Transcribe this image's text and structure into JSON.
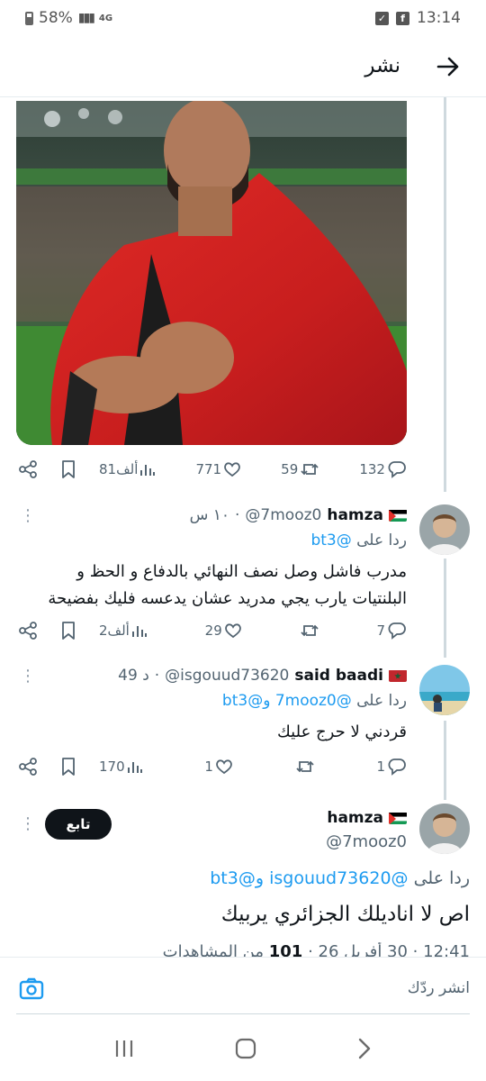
{
  "status_bar": {
    "battery": "58%",
    "network": "4G",
    "time": "13:14"
  },
  "header": {
    "title": "نشر"
  },
  "main_post_actions": {
    "replies": "132",
    "reposts": "59",
    "likes": "771",
    "views": "81ألف"
  },
  "replies": [
    {
      "name": "hamza",
      "handle": "@7mooz0",
      "time": "١٠ س",
      "reply_to_prefix": "ردا على",
      "reply_to": "@bt3",
      "text": "مدرب فاشل وصل نصف النهائي بالدفاع و الحظ و البلنتيات يارب يجي مدريد عشان يدعسه فليك بفضيحة",
      "replies": "7",
      "reposts": "",
      "likes": "29",
      "views": "2ألف"
    },
    {
      "name": "said baadi",
      "handle": "@isgouud73620",
      "time": "49 د",
      "reply_to_prefix": "ردا على",
      "reply_to": "@7mooz0 و@bt3",
      "text": "قردني لا حرج عليك",
      "replies": "1",
      "reposts": "",
      "likes": "1",
      "views": "170"
    }
  ],
  "focused_post": {
    "name": "hamza",
    "handle": "@7mooz0",
    "follow_label": "تابع",
    "reply_to_prefix": "ردا على",
    "reply_to": "@isgouud73620 و@bt3",
    "text": "اص لا اناديلك الجزائري يربيك",
    "meta_time": "12:41 · 30 أفريل 26 ·",
    "meta_views": "101",
    "meta_views_label": "من المشاهدات"
  },
  "compose": {
    "placeholder": "انشر ردّك"
  }
}
